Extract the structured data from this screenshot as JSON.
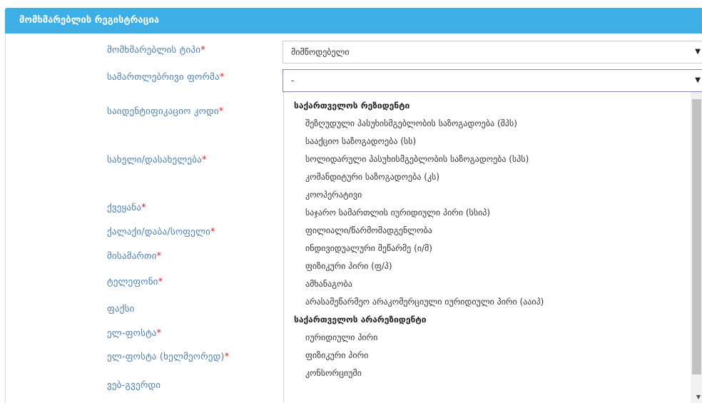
{
  "header": {
    "title": "მომხმარებლის რეგისტრაცია"
  },
  "fields": [
    {
      "label": "მომხმარებლის ტიპი",
      "required": "*"
    },
    {
      "label": "სამართლებრივი ფორმა",
      "required": "*"
    },
    {
      "label": "საიდენტიფიკაციო კოდი",
      "required": "*"
    },
    {
      "label": "სახელი/დასახელება",
      "required": "*"
    },
    {
      "label": "ქვეყანა",
      "required": "*"
    },
    {
      "label": "ქალაქი/დაბა/სოფელი",
      "required": "*"
    },
    {
      "label": "მისამართი",
      "required": "*"
    },
    {
      "label": "ტელეფონი",
      "required": "*"
    },
    {
      "label": "ფაქსი",
      "required": ""
    },
    {
      "label": "ელ-ფოსტა",
      "required": "*"
    },
    {
      "label": "ელ-ფოსტა (ხელმეორედ)",
      "required": "*"
    },
    {
      "label": "ვებ-გვერდი",
      "required": ""
    }
  ],
  "user_type_select": {
    "value": "მიმწოდებელი"
  },
  "legal_form_select": {
    "value": "-"
  },
  "dropdown": {
    "groups": [
      {
        "label": "საქართველოს რეზიდენტი",
        "options": [
          "შეზღუდული პასუხისმგებლობის საზოგადოება (შპს)",
          "სააქციო საზოგადოება (სს)",
          "სოლიდარული პასუხისმგებლობის საზოგადოება (სპს)",
          "კომანდიტური საზოგადოება (კს)",
          "კოოპერატივი",
          "საჯარო სამართლის იურიდიული პირი (სსიპ)",
          "ფილიალი/წარმომადგენლობა",
          "ინდივიდუალური მეწარმე (ი/მ)",
          "ფიზიკური პირი (ფ/პ)",
          "ამხანაგობა",
          "არასამეწარმეო არაკომერციული იურიდიული პირი (ააიპ)"
        ]
      },
      {
        "label": "საქართველოს არარეზიდენტი",
        "options": [
          "იურიდიული პირი",
          "ფიზიკური პირი",
          "კონსორციუმი"
        ]
      }
    ]
  },
  "icons": {
    "caret": "dropdown-caret-icon",
    "scroll_down": "scroll-down-arrow-icon"
  }
}
